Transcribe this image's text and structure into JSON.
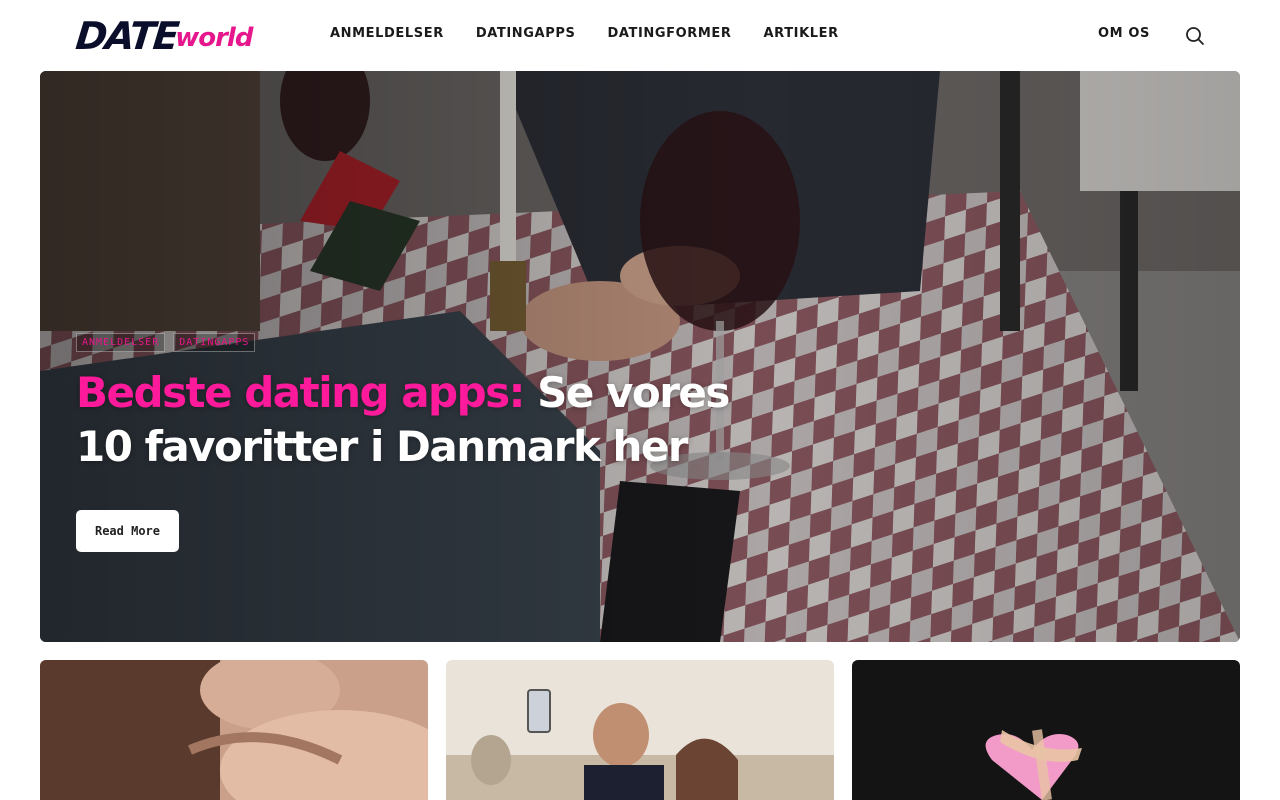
{
  "header": {
    "logo_main": "DATE",
    "logo_accent": "world",
    "nav": [
      "ANMELDELSER",
      "DATINGAPPS",
      "DATINGFORMER",
      "ARTIKLER"
    ],
    "nav_right": "OM OS"
  },
  "hero": {
    "tags": [
      "ANMELDELSER",
      "DATINGAPPS"
    ],
    "title_accent": "Bedste dating apps:",
    "title_rest": "Se vores 10 favoritter i Danmark her",
    "button_label": "Read More"
  },
  "colors": {
    "brand_navy": "#0b0e2a",
    "brand_pink": "#e6178c"
  }
}
